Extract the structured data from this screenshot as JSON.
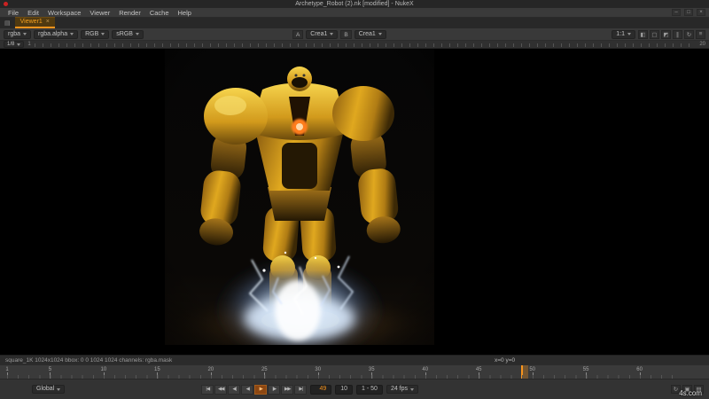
{
  "window": {
    "title": "Archetype_Robot (2).nk [modified] - NukeX",
    "controls": [
      {
        "name": "minimize-button",
        "glyph": "–"
      },
      {
        "name": "maximize-button",
        "glyph": "□"
      },
      {
        "name": "close-button",
        "glyph": "×"
      }
    ]
  },
  "menubar": {
    "items": [
      "File",
      "Edit",
      "Workspace",
      "Viewer",
      "Render",
      "Cache",
      "Help"
    ]
  },
  "tabstrip": {
    "pane_icon_glyph": "▤",
    "viewer_tab": "Viewer1",
    "close_glyph": "×"
  },
  "viewer_toolbar": {
    "channels": "rgba",
    "alpha": "rgba.alpha",
    "display": "RGB",
    "colorspace": "sRGB",
    "input_a_label": "A",
    "input_a": "Crea1",
    "input_b_label": "B",
    "input_b": "Crea1",
    "zoom": "1:1",
    "right_icons": [
      {
        "name": "wipe-mode-icon",
        "glyph": "◧"
      },
      {
        "name": "roi-icon",
        "glyph": "▢"
      },
      {
        "name": "proxy-toggle-icon",
        "glyph": "◩"
      },
      {
        "name": "pause-updates-icon",
        "glyph": "∥"
      },
      {
        "name": "refresh-icon",
        "glyph": "↻"
      },
      {
        "name": "viewer-settings-icon",
        "glyph": "≡"
      }
    ]
  },
  "proxy_bar": {
    "downrez": "1/8",
    "left_value": "1",
    "right_value": "20"
  },
  "info_bar": {
    "format_info": "square_1K 1024x1024   bbox: 0 0 1024 1024   channels: rgba.mask",
    "cursor_info": "x=0 y=0"
  },
  "timeline": {
    "domain": {
      "start": 1,
      "end": 64
    },
    "ticks": [
      1,
      5,
      10,
      15,
      20,
      25,
      30,
      35,
      40,
      45,
      50,
      55,
      60
    ],
    "playhead_frame": 49,
    "current_frame": "49",
    "increment": "10",
    "range": "1 - 50",
    "fps": "24 fps",
    "range_mode": "Global",
    "transport_buttons": [
      {
        "name": "goto-start-button",
        "glyph": "|◀"
      },
      {
        "name": "play-backward-fast-button",
        "glyph": "◀◀"
      },
      {
        "name": "step-back-button",
        "glyph": "◀|"
      },
      {
        "name": "play-backward-button",
        "glyph": "◀"
      },
      {
        "name": "play-forward-button",
        "glyph": "▶",
        "active": true
      },
      {
        "name": "step-forward-button",
        "glyph": "|▶"
      },
      {
        "name": "play-forward-fast-button",
        "glyph": "▶▶"
      },
      {
        "name": "goto-end-button",
        "glyph": "▶|"
      }
    ],
    "right_icons": [
      {
        "name": "loop-mode-icon",
        "glyph": "↻"
      },
      {
        "name": "frame-range-lock-icon",
        "glyph": "▣"
      },
      {
        "name": "timeline-options-icon",
        "glyph": "▤"
      }
    ]
  },
  "watermark": "4s.com",
  "colors": {
    "accent_orange": "#f7941d",
    "glow_blue": "#cfe6ff",
    "armor_gold": "#d4a017"
  }
}
